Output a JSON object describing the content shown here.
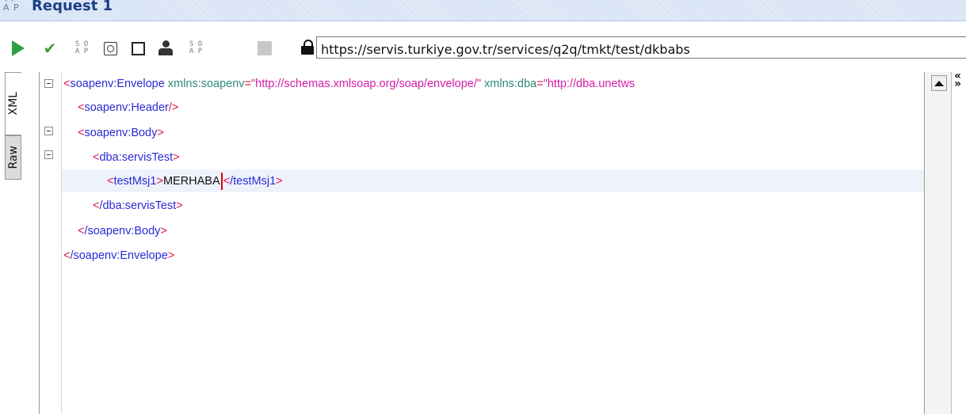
{
  "window": {
    "title": "Request 1",
    "icon_name": "soapui-ap-icon",
    "icon_label": "A P"
  },
  "toolbar": {
    "buttons": [
      {
        "icon": "run-icon",
        "color": "#2ea043"
      },
      {
        "icon": "check-icon"
      },
      {
        "icon": "so-icon",
        "label": "SO AP"
      },
      {
        "icon": "window-icon"
      },
      {
        "icon": "square-icon"
      },
      {
        "icon": "user-icon"
      },
      {
        "icon": "so-icon",
        "label": "SO AP"
      },
      {
        "icon": "gray-square-icon"
      }
    ],
    "url": "https://servis.turkiye.gov.tr/services/q2q/tmkt/test/dkbabs"
  },
  "tabs": [
    "XML",
    "Raw"
  ],
  "editor": {
    "lines": [
      {
        "indent": 0,
        "foldable": true,
        "text": "<soapenv:Envelope xmlns:soapenv=\"http://schemas.xmlsoap.org/soap/envelope/\" xmlns:dba=\"http://dba.unetws"
      },
      {
        "indent": 1,
        "foldable": false,
        "text": "<soapenv:Header/>"
      },
      {
        "indent": 1,
        "foldable": true,
        "text": "<soapenv:Body>"
      },
      {
        "indent": 2,
        "foldable": true,
        "text": "<dba:servisTest>"
      },
      {
        "indent": 3,
        "foldable": false,
        "text": "<testMsj1>MERHABA</testMsj1>"
      },
      {
        "indent": 2,
        "foldable": false,
        "text": "</dba:servisTest>"
      },
      {
        "indent": 1,
        "foldable": false,
        "text": "</soapenv:Body>"
      },
      {
        "indent": 0,
        "foldable": false,
        "text": "</soapenv:Envelope>"
      }
    ],
    "tokens": {
      "envelope_open": "soapenv:Envelope",
      "attr1_name": "xmlns:soapenv",
      "attr1_value": "\"http://schemas.xmlsoap.org/soap/envelope/\"",
      "attr2_name": "xmlns:dba",
      "attr2_value": "\"http://dba.unetws",
      "header": "soapenv:Header",
      "body_open": "soapenv:Body",
      "servis_open": "dba:servisTest",
      "msg_tag": "testMsj1",
      "msg_value": "MERHABA",
      "msg_close": "/testMsj1",
      "servis_close": "/dba:servisTest",
      "body_close": "/soapenv:Body",
      "envelope_close": "/soapenv:Envelope"
    },
    "colors": {
      "tag": "#2a2ad6",
      "bracket": "#e0124a",
      "attribute": "#2e8b7a",
      "value": "#d41aa8",
      "caret": "#e00000",
      "current_line": "#eef3fb"
    }
  }
}
